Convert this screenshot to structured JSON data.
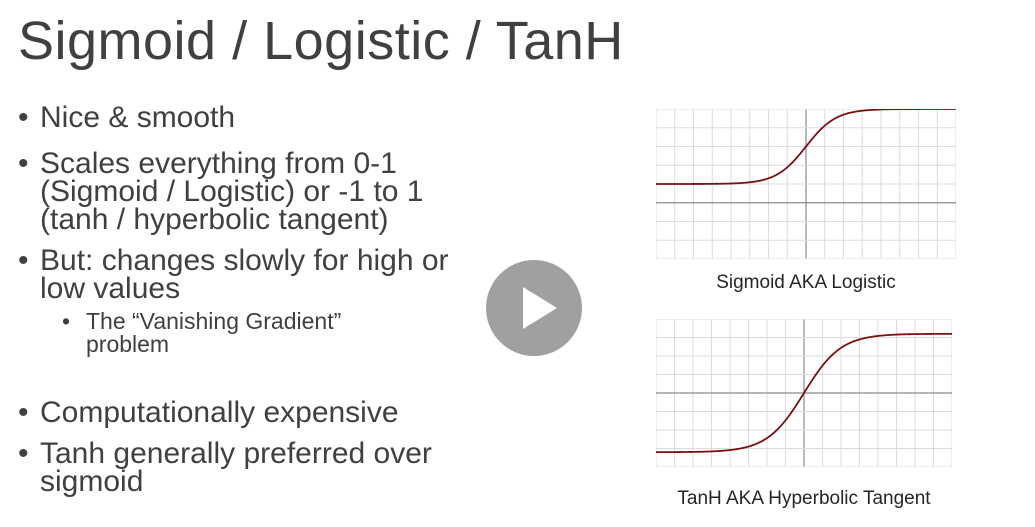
{
  "slide": {
    "title": "Sigmoid / Logistic / TanH",
    "bullet_symbol": "•",
    "bullets": [
      {
        "lines": [
          "Nice & smooth"
        ]
      },
      {
        "lines": [
          "Scales everything from 0-1",
          "(Sigmoid / Logistic) or -1 to 1",
          "(tanh / hyperbolic tangent)"
        ]
      },
      {
        "lines": [
          "But: changes slowly for high or",
          "low values"
        ],
        "sub": {
          "lines": [
            "The “Vanishing Gradient”",
            "problem"
          ]
        }
      },
      {
        "lines": [
          "Computationally expensive"
        ]
      },
      {
        "lines": [
          "Tanh generally preferred over",
          "sigmoid"
        ]
      }
    ]
  },
  "video": {
    "play_icon": "play-icon",
    "overlay_color": "#969696"
  },
  "charts": {
    "sigmoid": {
      "caption": "Sigmoid AKA Logistic",
      "function": "sigmoid",
      "xlim": [
        -10,
        10
      ],
      "ylim": [
        -1,
        1
      ],
      "grid": true,
      "curve_color": "#7b1010"
    },
    "tanh": {
      "caption": "TanH AKA Hyperbolic Tangent",
      "function": "tanh",
      "xlim": [
        -4,
        4
      ],
      "ylim": [
        -1.25,
        1.25
      ],
      "grid": true,
      "curve_color": "#7b1010"
    }
  }
}
